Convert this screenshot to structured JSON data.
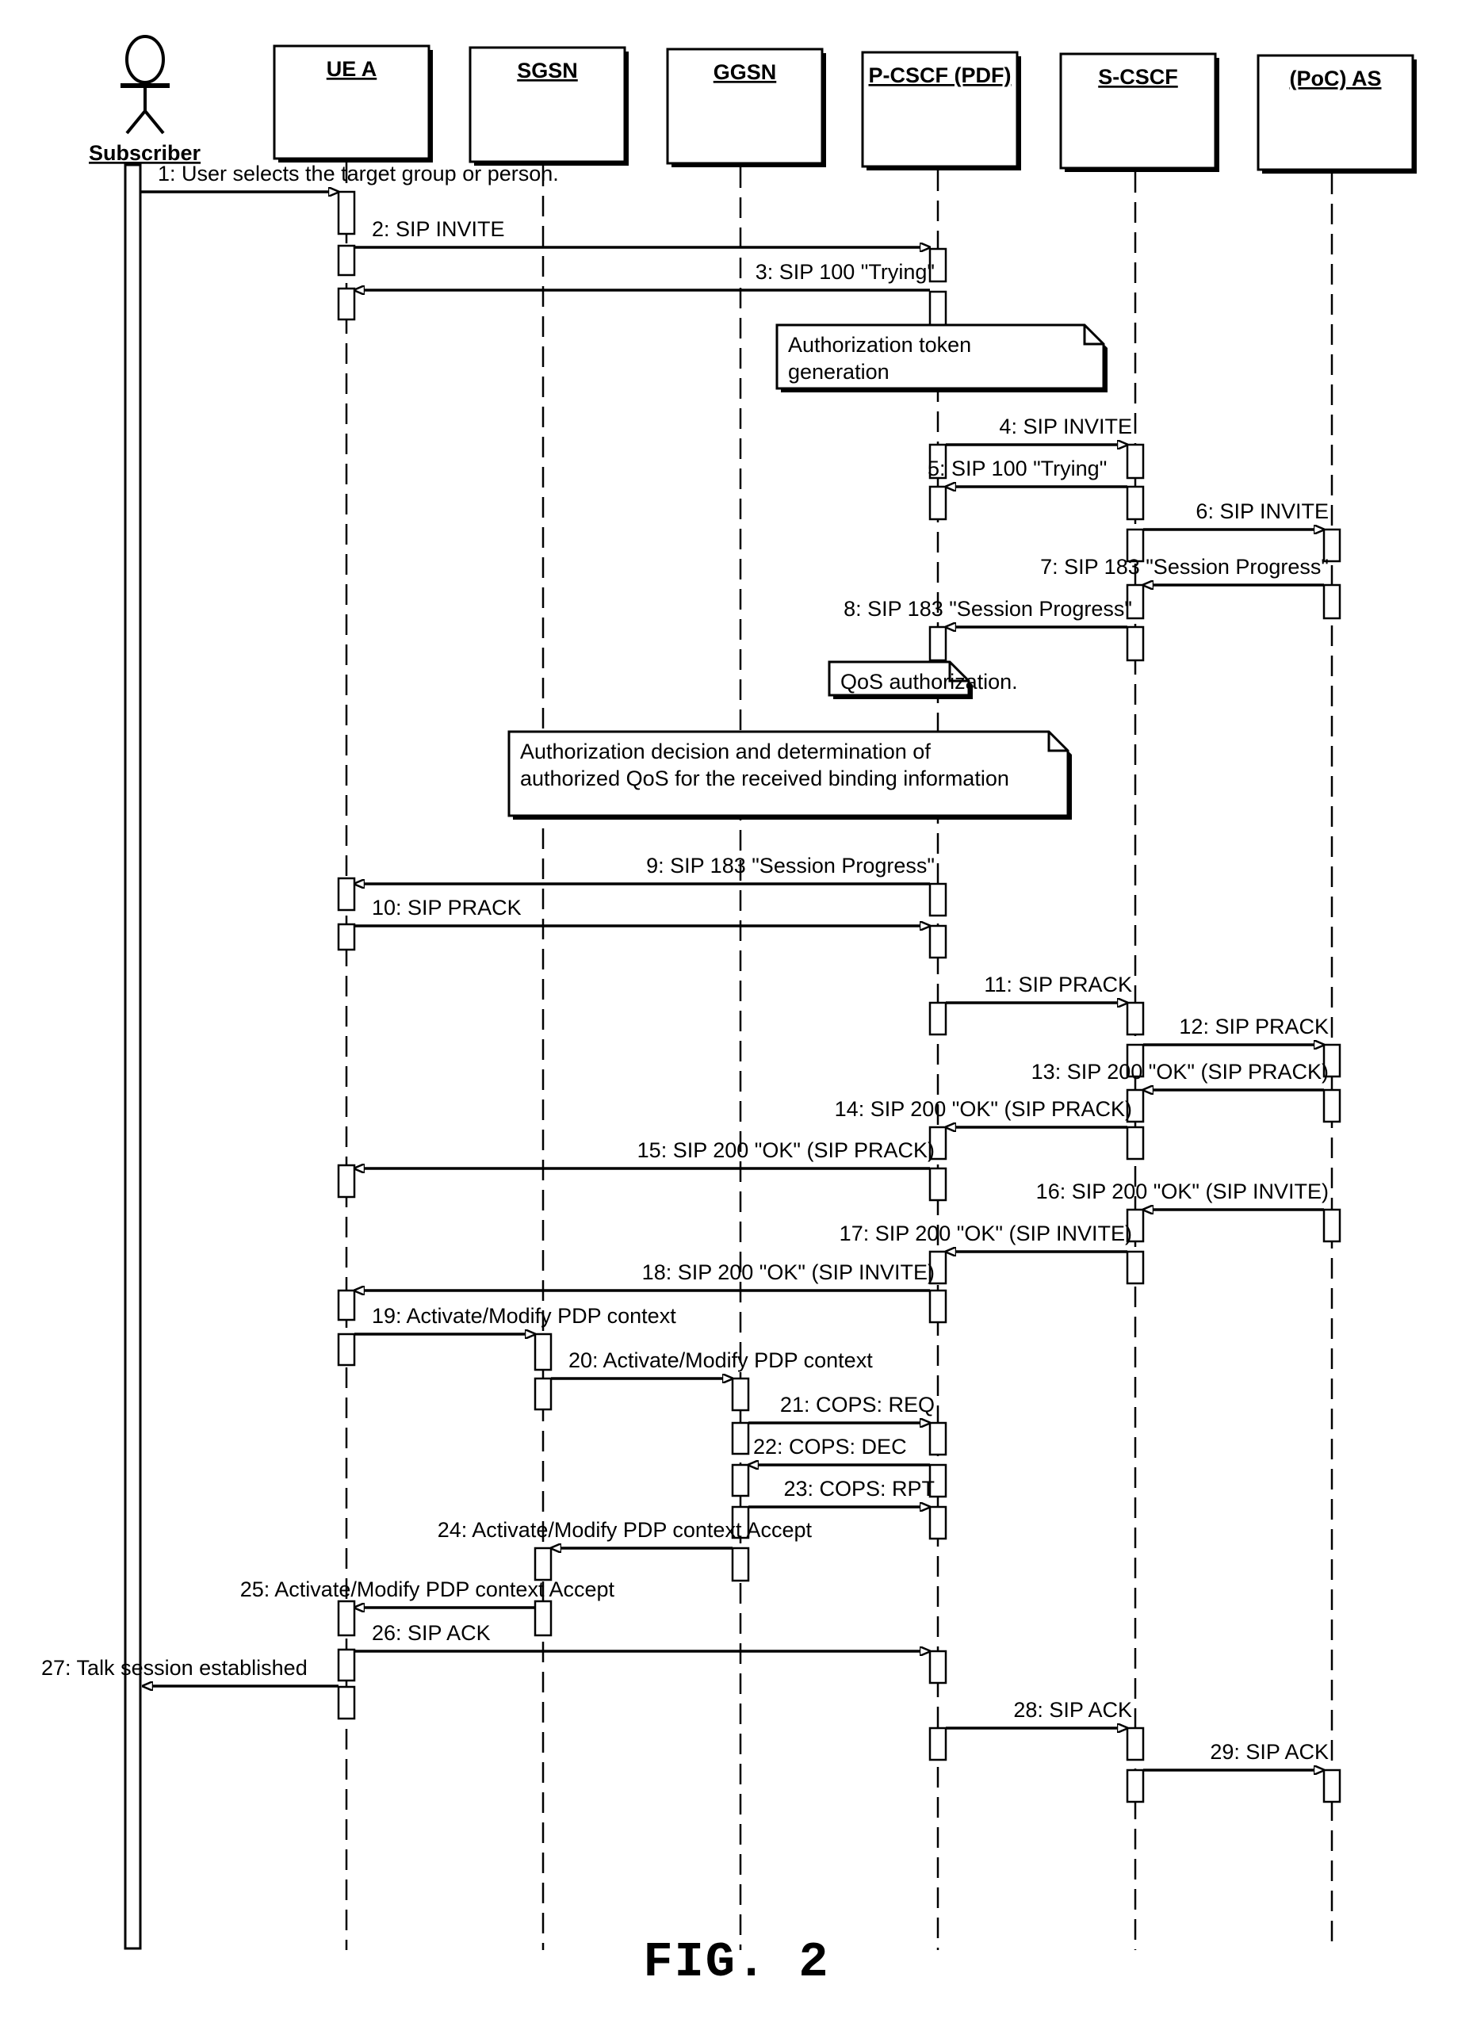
{
  "figure": {
    "caption": "FIG. 2",
    "diagram_type": "UML sequence diagram"
  },
  "actor": {
    "id": "subscriber",
    "label": "Subscriber",
    "icon": "stick-figure-icon"
  },
  "lifelines": [
    {
      "id": "ue",
      "label": "UE A"
    },
    {
      "id": "sgsn",
      "label": "SGSN"
    },
    {
      "id": "ggsn",
      "label": "GGSN"
    },
    {
      "id": "pcscf",
      "label": "P-CSCF (PDF)"
    },
    {
      "id": "scscf",
      "label": "S-CSCF"
    },
    {
      "id": "as",
      "label": "(PoC) AS"
    }
  ],
  "messages": [
    {
      "n": 1,
      "from": "subscriber",
      "to": "ue",
      "text": "1: User selects the target group or person."
    },
    {
      "n": 2,
      "from": "ue",
      "to": "pcscf",
      "text": "2: SIP INVITE"
    },
    {
      "n": 3,
      "from": "pcscf",
      "to": "ue",
      "text": "3: SIP 100 \"Trying\""
    },
    {
      "n": 4,
      "from": "pcscf",
      "to": "scscf",
      "text": "4: SIP INVITE"
    },
    {
      "n": 5,
      "from": "scscf",
      "to": "pcscf",
      "text": "5: SIP 100 \"Trying\""
    },
    {
      "n": 6,
      "from": "scscf",
      "to": "as",
      "text": "6: SIP INVITE"
    },
    {
      "n": 7,
      "from": "as",
      "to": "scscf",
      "text": "7: SIP 183 \"Session Progress\""
    },
    {
      "n": 8,
      "from": "scscf",
      "to": "pcscf",
      "text": "8: SIP 183 \"Session Progress\""
    },
    {
      "n": 9,
      "from": "pcscf",
      "to": "ue",
      "text": "9: SIP 183 \"Session Progress\""
    },
    {
      "n": 10,
      "from": "ue",
      "to": "pcscf",
      "text": "10: SIP PRACK"
    },
    {
      "n": 11,
      "from": "pcscf",
      "to": "scscf",
      "text": "11: SIP PRACK"
    },
    {
      "n": 12,
      "from": "scscf",
      "to": "as",
      "text": "12: SIP PRACK"
    },
    {
      "n": 13,
      "from": "as",
      "to": "scscf",
      "text": "13: SIP 200 \"OK\" (SIP PRACK)"
    },
    {
      "n": 14,
      "from": "scscf",
      "to": "pcscf",
      "text": "14: SIP 200 \"OK\" (SIP PRACK)"
    },
    {
      "n": 15,
      "from": "pcscf",
      "to": "ue",
      "text": "15: SIP 200 \"OK\" (SIP PRACK)"
    },
    {
      "n": 16,
      "from": "as",
      "to": "scscf",
      "text": "16: SIP 200 \"OK\" (SIP INVITE)"
    },
    {
      "n": 17,
      "from": "scscf",
      "to": "pcscf",
      "text": "17: SIP 200 \"OK\" (SIP INVITE)"
    },
    {
      "n": 18,
      "from": "pcscf",
      "to": "ue",
      "text": "18: SIP 200 \"OK\" (SIP INVITE)"
    },
    {
      "n": 19,
      "from": "ue",
      "to": "sgsn",
      "text": "19: Activate/Modify PDP context"
    },
    {
      "n": 20,
      "from": "sgsn",
      "to": "ggsn",
      "text": "20: Activate/Modify PDP context"
    },
    {
      "n": 21,
      "from": "ggsn",
      "to": "pcscf",
      "text": "21: COPS: REQ"
    },
    {
      "n": 22,
      "from": "pcscf",
      "to": "ggsn",
      "text": "22: COPS: DEC"
    },
    {
      "n": 23,
      "from": "ggsn",
      "to": "pcscf",
      "text": "23: COPS: RPT"
    },
    {
      "n": 24,
      "from": "ggsn",
      "to": "sgsn",
      "text": "24: Activate/Modify PDP context Accept"
    },
    {
      "n": 25,
      "from": "sgsn",
      "to": "ue",
      "text": "25: Activate/Modify PDP context Accept"
    },
    {
      "n": 26,
      "from": "ue",
      "to": "pcscf",
      "text": "26: SIP ACK"
    },
    {
      "n": 27,
      "from": "ue",
      "to": "subscriber",
      "text": "27: Talk session established"
    },
    {
      "n": 28,
      "from": "pcscf",
      "to": "scscf",
      "text": "28: SIP ACK"
    },
    {
      "n": 29,
      "from": "scscf",
      "to": "as",
      "text": "29: SIP ACK"
    }
  ],
  "notes": [
    {
      "id": "note-token",
      "lines": [
        "Authorization token",
        "generation"
      ]
    },
    {
      "id": "note-qos",
      "lines": [
        "QoS authorization."
      ]
    },
    {
      "id": "note-decision",
      "lines": [
        "Authorization decision and determination of",
        "authorized QoS for the received binding information"
      ]
    }
  ]
}
